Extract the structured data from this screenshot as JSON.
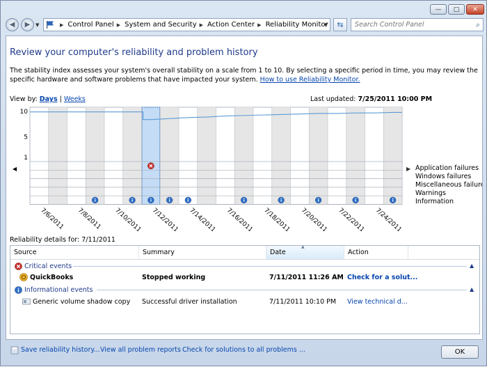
{
  "window": {
    "caption_buttons": {
      "minimize": "—",
      "maximize": "□",
      "close": "✕"
    }
  },
  "address_bar": {
    "crumbs": [
      "Control Panel",
      "System and Security",
      "Action Center",
      "Reliability Monitor"
    ],
    "search_placeholder": "Search Control Panel"
  },
  "page": {
    "title": "Review your computer's reliability and problem history",
    "description": "The stability index assesses your system's overall stability on a scale from 1 to 10. By selecting a specific period in time, you may review the specific hardware and software problems that have impacted your system.",
    "help_link": "How to use Reliability Monitor.",
    "view_by_label": "View by:",
    "view_days": "Days",
    "view_sep": "|",
    "view_weeks": "Weeks",
    "last_updated_label": "Last updated:",
    "last_updated_value": "7/25/2011 10:00 PM"
  },
  "chart_data": {
    "type": "line",
    "y_ticks": [
      "10",
      "5",
      "1"
    ],
    "ylim": [
      1,
      10
    ],
    "x_labels": [
      "7/6/2011",
      "7/8/2011",
      "7/10/2011",
      "7/12/2011",
      "7/14/2011",
      "7/16/2011",
      "7/18/2011",
      "7/20/2011",
      "7/22/2011",
      "7/24/2011"
    ],
    "day_count": 20,
    "selected_day": 6,
    "stability": [
      9.9,
      9.9,
      9.9,
      9.9,
      9.9,
      9.9,
      8.4,
      8.6,
      8.8,
      8.9,
      9.1,
      9.2,
      9.3,
      9.4,
      9.5,
      9.6,
      9.6,
      9.7,
      9.7,
      9.8
    ],
    "rows": [
      "Application failures",
      "Windows failures",
      "Miscellaneous failures",
      "Warnings",
      "Information"
    ],
    "critical_events": [
      {
        "day": 6,
        "row": 0
      }
    ],
    "info_events": [
      2,
      4,
      5,
      6,
      7,
      8,
      11,
      13,
      15,
      17,
      20,
      22
    ],
    "info_event_days": [
      3,
      5,
      6,
      7,
      8,
      11,
      13,
      15,
      17,
      19
    ]
  },
  "details": {
    "label": "Reliability details for: 7/11/2011",
    "columns": [
      "Source",
      "Summary",
      "Date",
      "Action"
    ],
    "groups": [
      {
        "name": "Critical events",
        "icon": "critical-icon"
      },
      {
        "name": "Informational events",
        "icon": "info-icon"
      }
    ],
    "critical_row": {
      "source": "QuickBooks",
      "summary": "Stopped working",
      "date": "7/11/2011 11:26 AM",
      "action": "Check for a solut..."
    },
    "info_row": {
      "source": "Generic volume shadow copy",
      "summary": "Successful driver installation",
      "date": "7/11/2011 10:10 PM",
      "action": "View  technical d..."
    }
  },
  "footer": {
    "save_history": "Save reliability history...",
    "view_reports": "View all problem reports",
    "check_solutions": "Check for solutions to all problems ...",
    "ok": "OK"
  },
  "colors": {
    "accent": "#1e3a8a",
    "link": "#0645ad",
    "selected_col": "#c4dcf5",
    "line": "#5b9bd5"
  }
}
